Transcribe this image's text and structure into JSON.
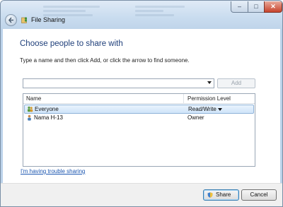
{
  "window": {
    "title": "File Sharing"
  },
  "dialog": {
    "heading": "Choose people to share with",
    "instruction": "Type a name and then click Add, or click the arrow to find someone.",
    "name_input": {
      "value": "",
      "placeholder": ""
    },
    "add_label": "Add"
  },
  "list": {
    "columns": [
      "Name",
      "Permission Level"
    ],
    "rows": [
      {
        "name": "Everyone",
        "permission": "Read/Write",
        "selected": true,
        "icon": "group-icon"
      },
      {
        "name": "Nama H-13",
        "permission": "Owner",
        "selected": false,
        "icon": "user-icon"
      }
    ]
  },
  "help_link": "I'm having trouble sharing",
  "footer": {
    "share_label": "Share",
    "cancel_label": "Cancel"
  },
  "colors": {
    "heading": "#1f3f7a",
    "link": "#1a55b0",
    "selection": "#cfe4f9",
    "close_button": "#c7432b"
  }
}
